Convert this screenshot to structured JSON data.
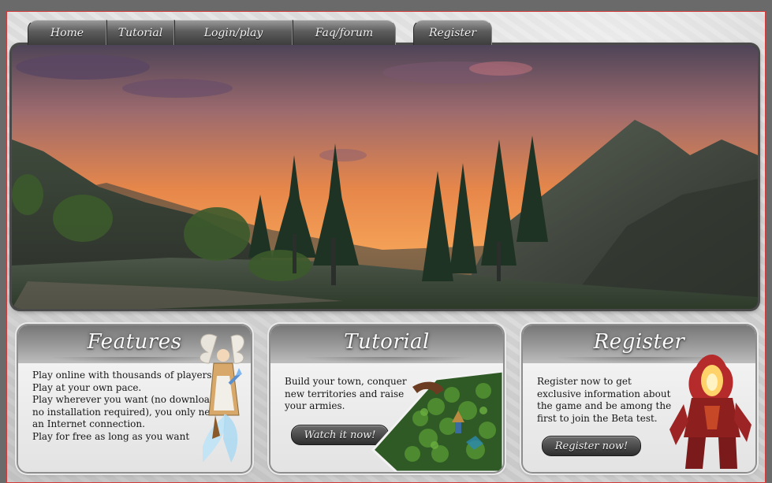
{
  "nav": {
    "tabs": [
      {
        "label": "Home"
      },
      {
        "label": "Tutorial"
      },
      {
        "label": "Login/play"
      },
      {
        "label": "Faq/forum"
      }
    ],
    "register": {
      "label": "Register"
    }
  },
  "banner": {
    "scene": "sunset-mountain-forest"
  },
  "panels": {
    "features": {
      "title": "Features",
      "lines": [
        "Play online with thousands of players",
        "Play at your own pace.",
        "Play wherever you want (no download,",
        "no installation required), you only need",
        "an Internet connection.",
        "Play for free as long as you want"
      ]
    },
    "tutorial": {
      "title": "Tutorial",
      "lines": [
        "Build your town, conquer",
        "new territories and raise",
        "your armies."
      ],
      "button": "Watch it now!"
    },
    "register": {
      "title": "Register",
      "lines": [
        "Register now to get",
        "exclusive information about",
        "the game and be among the",
        "first to join the Beta test."
      ],
      "button": "Register now!"
    }
  },
  "colors": {
    "frame_border": "#d23a3a",
    "tab_dark": "#3d3d3d",
    "sky_top": "#5b4a63",
    "sky_glow": "#f08a3c"
  }
}
